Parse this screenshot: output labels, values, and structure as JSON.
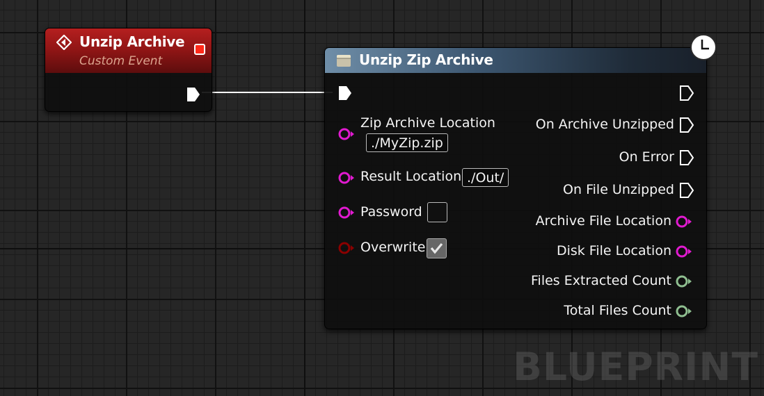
{
  "event_node": {
    "title": "Unzip Archive",
    "subtitle": "Custom Event",
    "header_color": "#8e1515"
  },
  "function_node": {
    "title": "Unzip Zip Archive",
    "header_color": "#3c5670",
    "inputs": {
      "zip_archive_location": {
        "label": "Zip Archive Location",
        "value": "./MyZip.zip"
      },
      "result_location": {
        "label": "Result Location",
        "value": "./Out/"
      },
      "password": {
        "label": "Password",
        "checked": false
      },
      "overwrite": {
        "label": "Overwrite",
        "checked": true
      }
    },
    "outputs": {
      "on_archive_unzipped": "On Archive Unzipped",
      "on_error": "On Error",
      "on_file_unzipped": "On File Unzipped",
      "archive_file_location": "Archive File Location",
      "disk_file_location": "Disk File Location",
      "files_extracted_count": "Files Extracted Count",
      "total_files_count": "Total Files Count"
    }
  },
  "colors": {
    "string_pin": "#e11ad0",
    "bool_pin": "#8b0000",
    "int_pin": "#8fbf90",
    "exec_pin": "#ffffff"
  },
  "icons": {
    "event": "event-diamond-icon",
    "function": "function-box-icon",
    "latent": "clock-icon"
  },
  "watermark": "BLUEPRINT"
}
